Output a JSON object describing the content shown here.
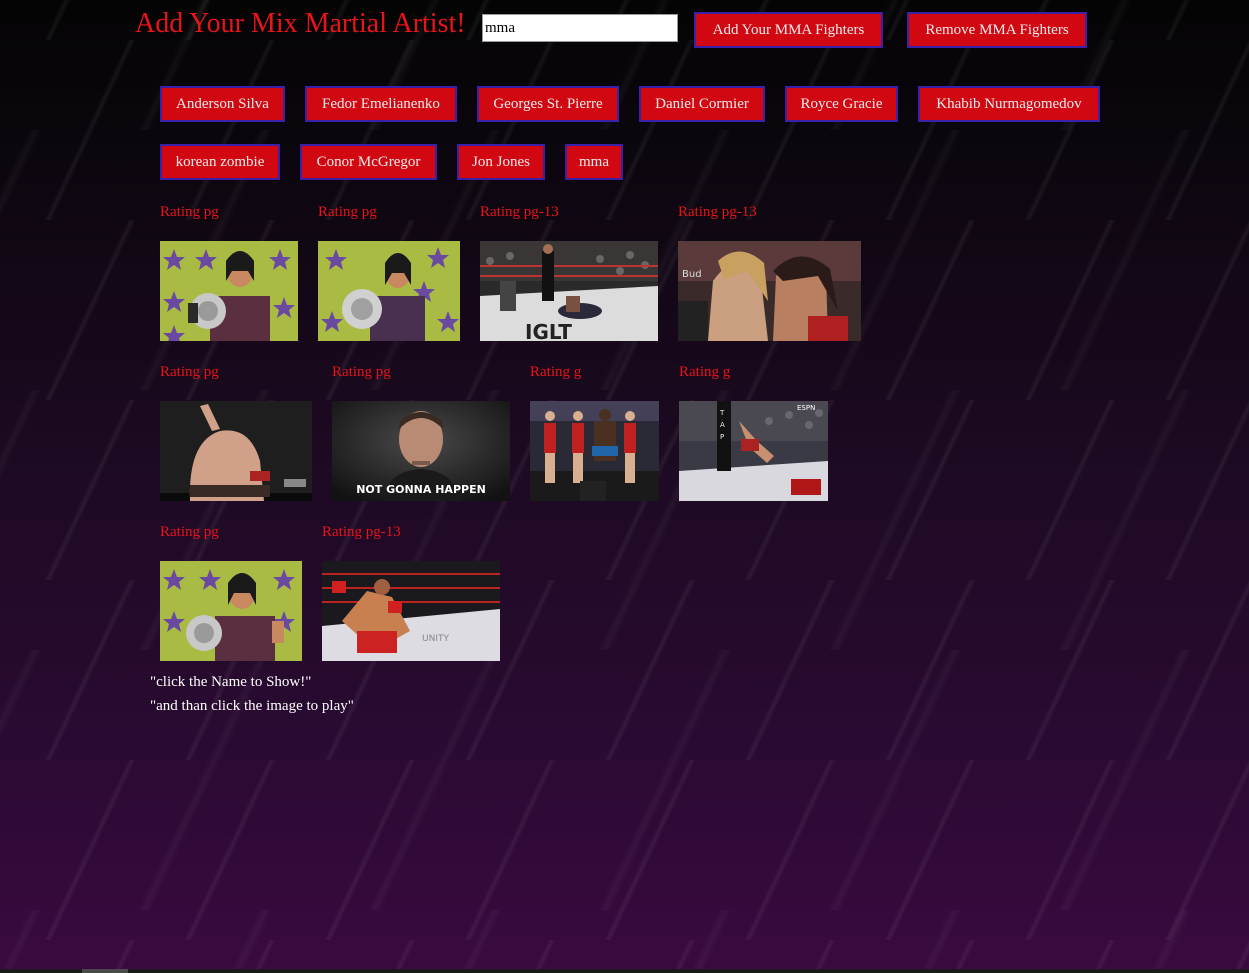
{
  "header": {
    "title": "Add Your Mix Martial Artist!",
    "input_value": "mma",
    "add_button": "Add Your MMA Fighters",
    "remove_button": "Remove MMA Fighters"
  },
  "fighters": [
    "Anderson Silva",
    "Fedor Emelianenko",
    "Georges St. Pierre",
    "Daniel Cormier",
    "Royce Gracie",
    "Khabib Nurmagomedov",
    "korean zombie",
    "Conor McGregor",
    "Jon Jones",
    "mma"
  ],
  "results": [
    {
      "rating": "Rating pg"
    },
    {
      "rating": "Rating pg"
    },
    {
      "rating": "Rating pg-13"
    },
    {
      "rating": "Rating pg-13"
    },
    {
      "rating": "Rating pg"
    },
    {
      "rating": "Rating pg",
      "caption": "NOT GONNA HAPPEN"
    },
    {
      "rating": "Rating g"
    },
    {
      "rating": "Rating g"
    },
    {
      "rating": "Rating pg"
    },
    {
      "rating": "Rating pg-13"
    }
  ],
  "instructions": {
    "line1": "\"click the Name to Show!\"",
    "line2": "\"and than click the image to play\""
  },
  "colors": {
    "accent": "#e8141a",
    "button_bg": "#d10812",
    "button_border": "#3b21a8"
  }
}
